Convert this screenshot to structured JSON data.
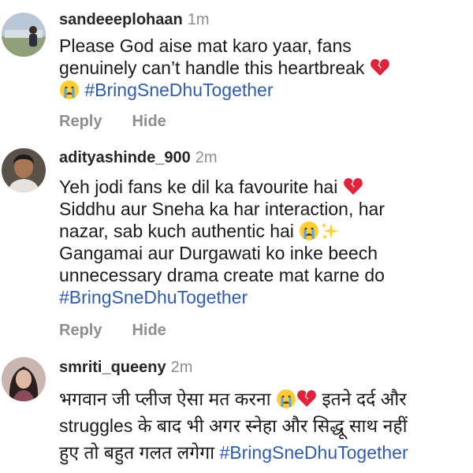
{
  "colors": {
    "hashtag": "#2f5bb1",
    "username": "#262626",
    "meta": "#8e8e8e",
    "text": "#1a1a1a"
  },
  "comments": [
    {
      "username": "sandeeeplohaan",
      "time": "1m",
      "avatar_icon": "user-photo-outdoor",
      "lines": [
        {
          "text": "Please God aise mat karo yaar, fans"
        },
        {
          "text": "genuinely can’t handle this heartbreak",
          "trailing_emoji": "broken-heart-icon"
        },
        {
          "leading_emoji": "crying-face-icon",
          "hashtag": "#BringSneDhuTogether"
        }
      ],
      "reply_label": "Reply",
      "hide_label": "Hide"
    },
    {
      "username": "adityashinde_900",
      "time": "2m",
      "avatar_icon": "user-photo-portrait",
      "lines": [
        {
          "text": "Yeh jodi fans ke dil ka favourite hai",
          "trailing_emoji": "broken-heart-icon"
        },
        {
          "text": "Siddhu aur Sneha ka har interaction, har"
        },
        {
          "text": "nazar, sab kuch authentic hai",
          "trailing_emoji": "crying-face-icon",
          "trailing_emoji_2": "sparkles-icon"
        },
        {
          "text": "Gangamai aur Durgawati ko inke beech"
        },
        {
          "text": "unnecessary drama create mat karne do"
        },
        {
          "hashtag": "#BringSneDhuTogether"
        }
      ],
      "reply_label": "Reply",
      "hide_label": "Hide"
    },
    {
      "username": "smriti_queeny",
      "time": "2m",
      "avatar_icon": "user-photo-woman",
      "lines": [
        {
          "text": "भगवान जी प्लीज ऐसा मत करना",
          "trailing_emoji": "crying-face-icon",
          "trailing_emoji_2": "broken-heart-icon",
          "text_after": "इतने दर्द और"
        },
        {
          "text": "struggles के बाद भी अगर स्नेहा और सिद्धू साथ नहीं"
        },
        {
          "text": "हुए तो बहुत गलत लगेगा",
          "hashtag": "#BringSneDhuTogether"
        }
      ]
    }
  ]
}
